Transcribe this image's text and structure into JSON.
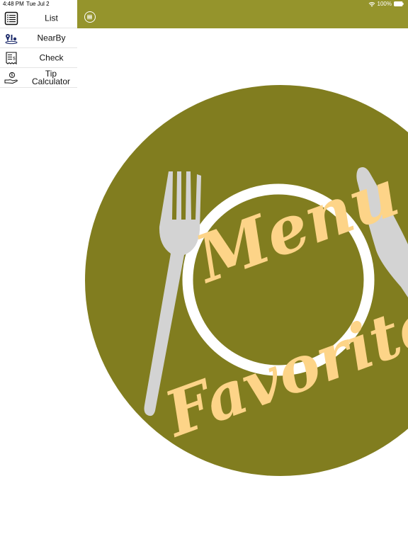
{
  "status_bar": {
    "time": "4:48 PM",
    "date": "Tue Jul 2",
    "battery": "100%"
  },
  "sidebar": {
    "items": [
      {
        "label": "List",
        "icon": "list-icon"
      },
      {
        "label": "NearBy",
        "icon": "map-pin-icon"
      },
      {
        "label": "Check",
        "icon": "receipt-icon"
      },
      {
        "label": "Tip Calculator",
        "icon": "tip-hand-icon"
      }
    ]
  },
  "topbar": {
    "menu_icon": "hamburger-circle-icon",
    "color": "#95942c"
  },
  "logo": {
    "line1": "Menu",
    "line2": "Favorites",
    "plate_color": "#817d1f",
    "text_color": "#fdd488",
    "utensil_color": "#d3d3d3"
  }
}
